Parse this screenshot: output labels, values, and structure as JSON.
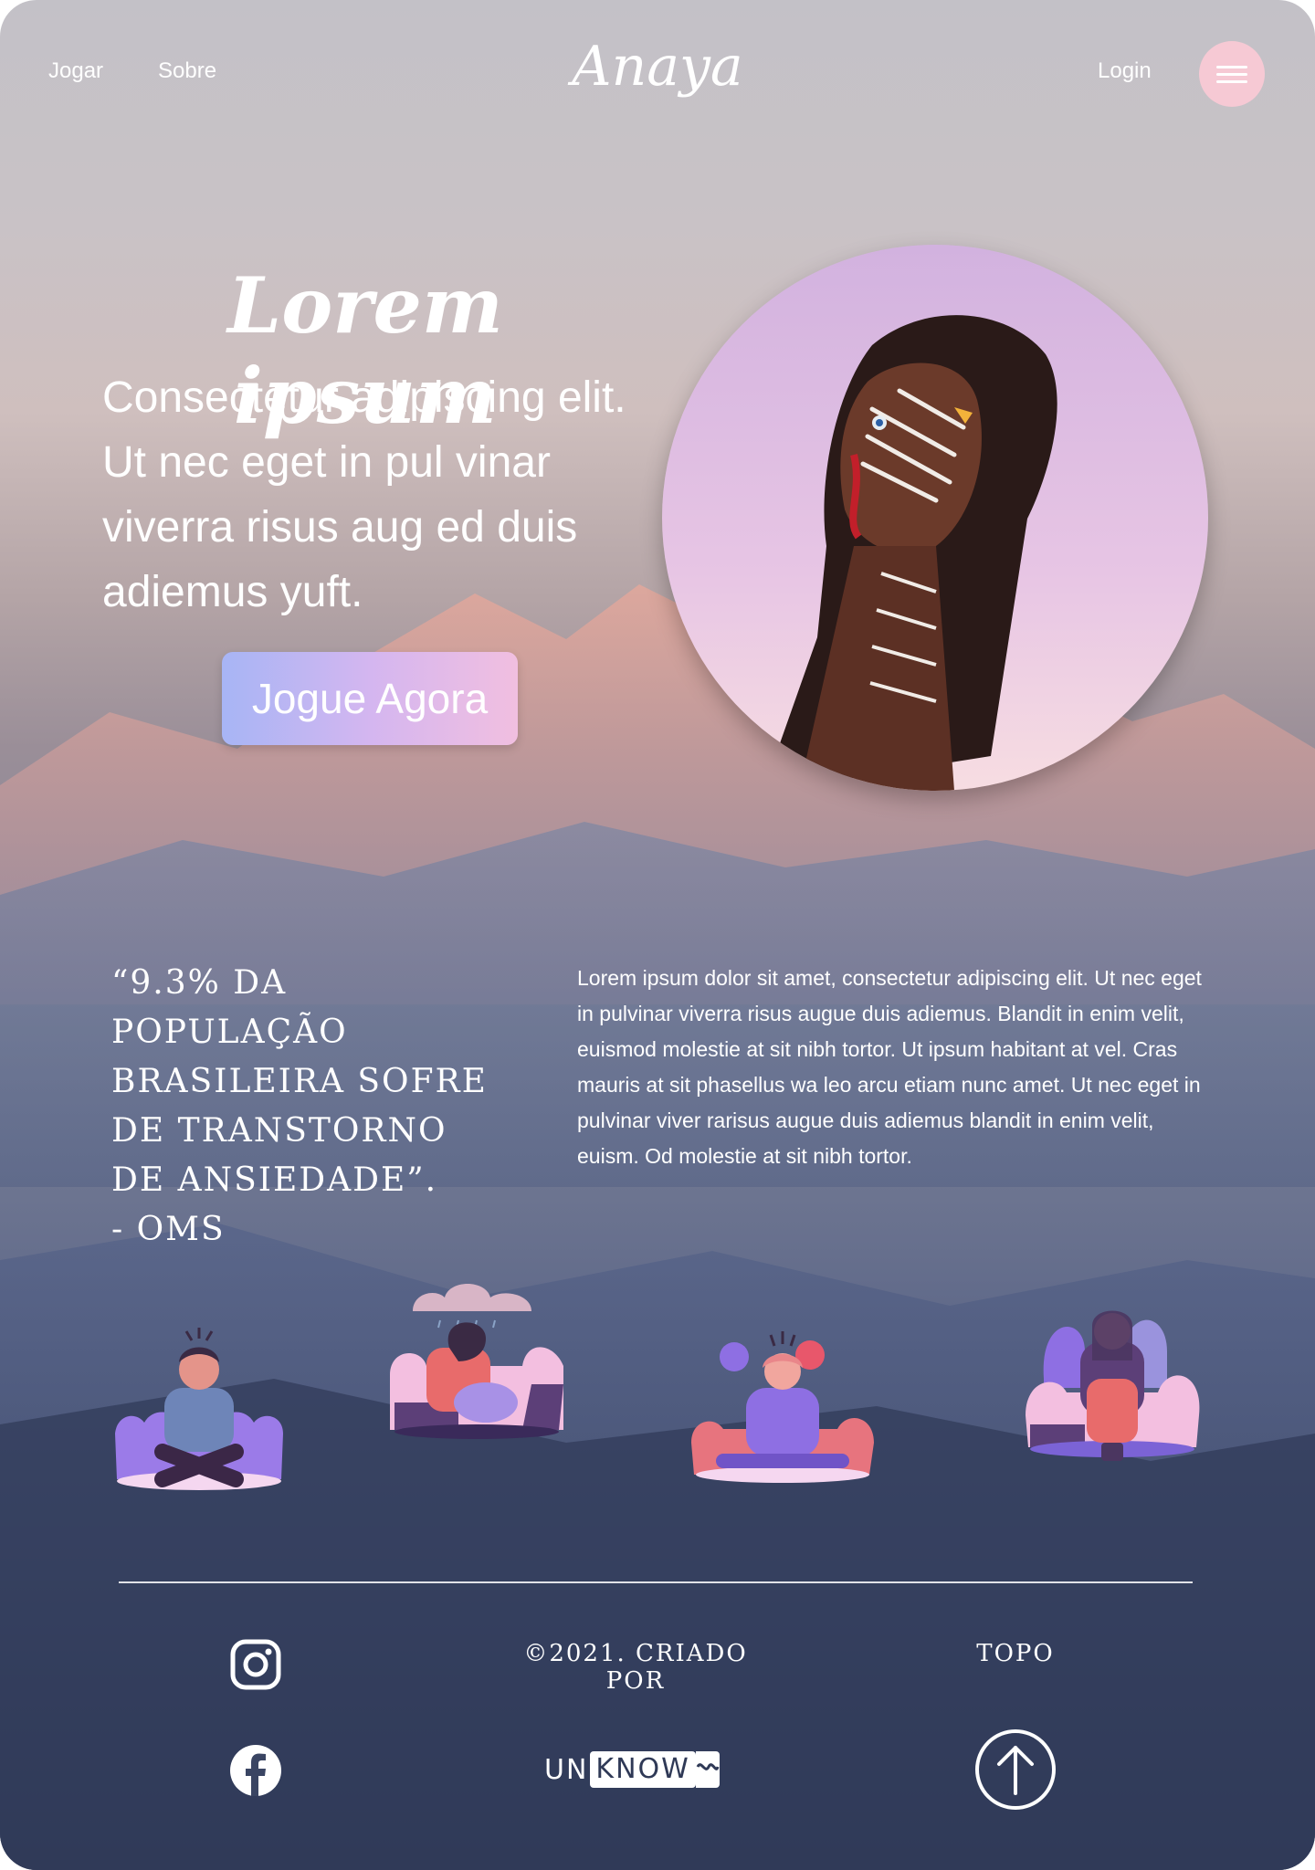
{
  "nav": {
    "links": [
      "Jogar",
      "Sobre"
    ],
    "brand": "Anaya",
    "login": "Login",
    "menu_icon": "hamburger-icon"
  },
  "hero": {
    "title": "Lorem ipsum",
    "subtitle": "Consectetur adipiscing elit. Ut nec eget in pul vinar viverra risus aug ed duis adiemus yuft.",
    "cta": "Jogue Agora",
    "image": "portrait-face-paint"
  },
  "stats": {
    "quote": "“9.3% da população brasileira sofre de transtorno de ansiedade”.",
    "source": "- OMS",
    "paragraph": "Lorem ipsum dolor sit amet, consectetur adipiscing elit. Ut nec eget in pulvinar viverra risus augue duis adiemus. Blandit in enim velit, euismod molestie at sit nibh tortor. Ut ipsum habitant at vel. Cras mauris at sit phasellus wa leo arcu etiam nunc amet. Ut nec eget in pulvinar viver rarisus augue duis adiemus blandit in enim velit, euism. Od molestie at sit nibh tortor."
  },
  "illustrations": [
    "anxious-person-illustration",
    "sad-person-rain-cloud-illustration",
    "stressed-meditating-person-illustration",
    "scared-person-ghosts-illustration"
  ],
  "footer": {
    "copyright": "©2021. Criado por",
    "top_label": "Topo",
    "brand_pre": "UN",
    "brand_box": "KNOW",
    "icons": [
      "instagram-icon",
      "facebook-icon",
      "arrow-up-icon"
    ]
  },
  "colors": {
    "accent_pink": "#f6c9d4",
    "button_gradient_start": "#a7b5f5",
    "button_gradient_end": "#f1bfe0",
    "footer_navy": "#2e3854"
  }
}
